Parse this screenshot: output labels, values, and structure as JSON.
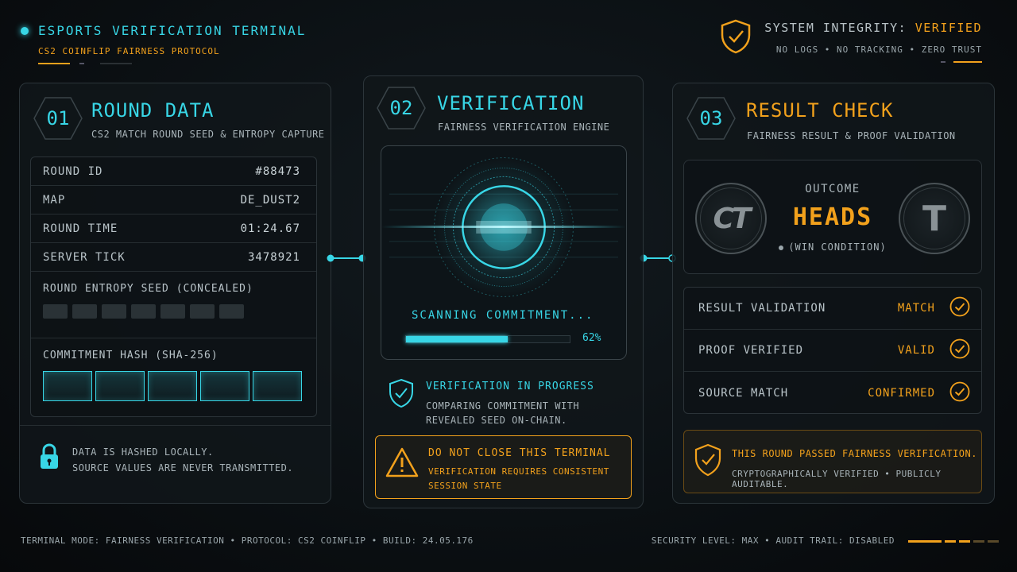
{
  "header": {
    "title": "ESPORTS VERIFICATION TERMINAL",
    "subtitle": "CS2 COINFLIP FAIRNESS PROTOCOL",
    "integrity_label": "SYSTEM INTEGRITY: ",
    "integrity_value": "VERIFIED",
    "integrity_sub": "NO LOGS • NO TRACKING • ZERO TRUST"
  },
  "panel1": {
    "number": "01",
    "title": "ROUND DATA",
    "subtitle": "CS2 MATCH ROUND SEED & ENTROPY CAPTURE",
    "rows": [
      {
        "label": "ROUND ID",
        "value": "#88473"
      },
      {
        "label": "MAP",
        "value": "DE_DUST2"
      },
      {
        "label": "ROUND TIME",
        "value": "01:24.67"
      },
      {
        "label": "SERVER TICK",
        "value": "3478921"
      }
    ],
    "seed_label": "ROUND ENTROPY SEED (CONCEALED)",
    "hash_label": "COMMITMENT HASH (SHA-256)",
    "footer_line1": "DATA IS HASHED LOCALLY.",
    "footer_line2": "SOURCE VALUES ARE NEVER TRANSMITTED."
  },
  "panel2": {
    "number": "02",
    "title": "VERIFICATION",
    "subtitle": "FAIRNESS VERIFICATION ENGINE",
    "scan_text": "SCANNING COMMITMENT...",
    "progress": 62,
    "progress_label": "62%",
    "status_title": "VERIFICATION IN PROGRESS",
    "status_line1": "COMPARING COMMITMENT WITH",
    "status_line2": "REVEALED SEED ON-CHAIN.",
    "warn_title": "DO NOT CLOSE THIS TERMINAL",
    "warn_line1": "VERIFICATION REQUIRES CONSISTENT",
    "warn_line2": "SESSION STATE"
  },
  "panel3": {
    "number": "03",
    "title": "RESULT CHECK",
    "subtitle": "FAIRNESS RESULT & PROOF VALIDATION",
    "outcome_label": "OUTCOME",
    "outcome_value": "HEADS",
    "outcome_note": "(WIN CONDITION)",
    "coin_left": "CT",
    "coin_right": "T",
    "checks": [
      {
        "label": "RESULT VALIDATION",
        "value": "MATCH"
      },
      {
        "label": "PROOF VERIFIED",
        "value": "VALID"
      },
      {
        "label": "SOURCE MATCH",
        "value": "CONFIRMED"
      }
    ],
    "pass_title": "THIS ROUND PASSED FAIRNESS VERIFICATION.",
    "pass_sub": "CRYPTOGRAPHICALLY VERIFIED • PUBLICLY AUDITABLE."
  },
  "footer": {
    "left": "TERMINAL MODE: FAIRNESS VERIFICATION • PROTOCOL: CS2 COINFLIP • BUILD: 24.05.176",
    "right": "SECURITY LEVEL: MAX • AUDIT TRAIL: DISABLED"
  },
  "colors": {
    "accent": "#38d6e6",
    "warning": "#f2a11c"
  },
  "icons": [
    "status-dot-icon",
    "shield-check-icon",
    "lock-icon",
    "warning-triangle-icon",
    "check-circle-icon",
    "ct-coin-icon",
    "t-coin-icon"
  ]
}
